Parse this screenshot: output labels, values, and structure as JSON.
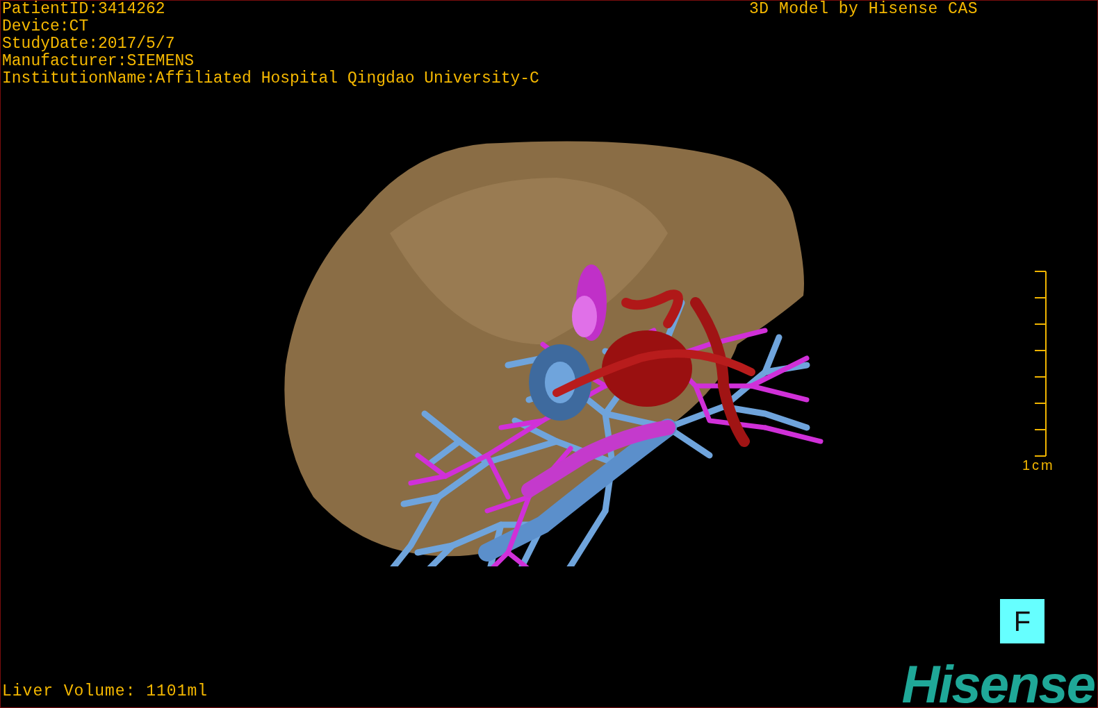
{
  "info_lines": [
    "PatientID:3414262",
    "Device:CT",
    "StudyDate:2017/5/7",
    "Manufacturer:SIEMENS",
    "InstitutionName:Affiliated Hospital Qingdao University-C"
  ],
  "title": "3D Model by Hisense CAS",
  "scale": {
    "label": "1cm"
  },
  "orientation_button": "F",
  "volume": "Liver Volume: 1101ml",
  "logo": "Hisense"
}
